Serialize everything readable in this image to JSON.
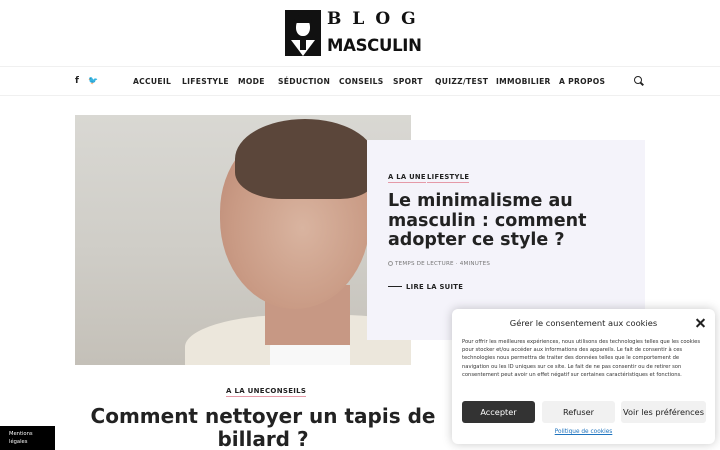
{
  "header": {
    "logo_line1": "BLOG",
    "logo_line2": "MASCULIN"
  },
  "social": {
    "facebook": "f",
    "twitter": "🐦"
  },
  "nav": {
    "items": [
      "ACCUEIL",
      "LIFESTYLE",
      "MODE",
      "SÉDUCTION",
      "CONSEILS",
      "SPORT",
      "QUIZZ/TEST",
      "IMMOBILIER",
      "A PROPOS"
    ]
  },
  "hero": {
    "tags": [
      "A LA UNE",
      "LIFESTYLE"
    ],
    "title": "Le minimalisme au masculin : comment adopter ce style ?",
    "meta": "TEMPS DE LECTURE · 4MINUTES",
    "read_more": "LIRE LA SUITE"
  },
  "article2": {
    "tags": [
      "A LA UNE",
      "CONSEILS"
    ],
    "title": "Comment nettoyer un tapis de billard ?"
  },
  "mentions": {
    "line1": "Mentions",
    "line2": "légales"
  },
  "consent": {
    "title": "Gérer le consentement aux cookies",
    "text": "Pour offrir les meilleures expériences, nous utilisons des technologies telles que les cookies pour stocker et/ou accéder aux informations des appareils. Le fait de consentir à ces technologies nous permettra de traiter des données telles que le comportement de navigation ou les ID uniques sur ce site. Le fait de ne pas consentir ou de retirer son consentement peut avoir un effet négatif sur certaines caractéristiques et fonctions.",
    "accept": "Accepter",
    "refuse": "Refuser",
    "preferences": "Voir les préférences",
    "policy": "Politique de cookies"
  },
  "colors": {
    "tag_underline": "#e59aa8",
    "card_bg": "#f4f3fa",
    "accept_bg": "#333333",
    "link": "#1e73be"
  }
}
